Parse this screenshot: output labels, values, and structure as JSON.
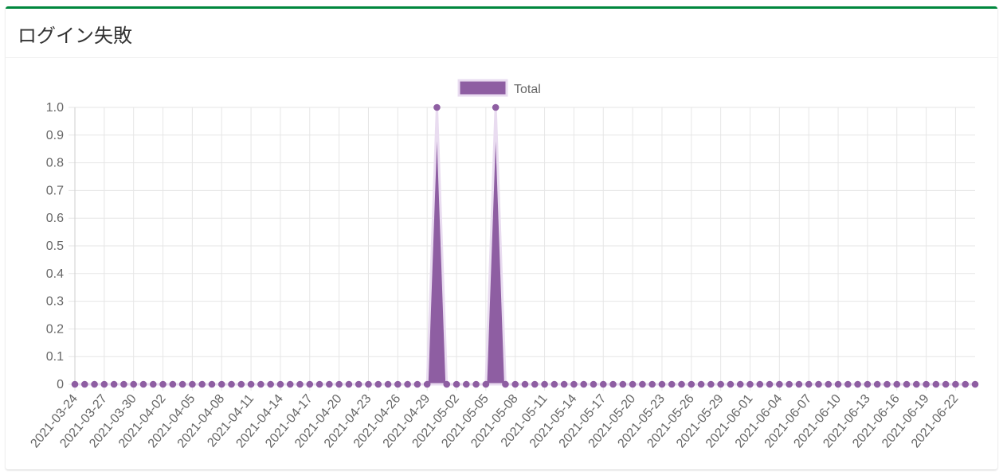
{
  "card": {
    "title": "ログイン失敗"
  },
  "chart_data": {
    "type": "area",
    "title": "",
    "xlabel": "",
    "ylabel": "",
    "series": [
      {
        "name": "Total",
        "color": "#8e5ea2"
      }
    ],
    "x_start": "2021-03-24",
    "x_end": "2021-06-24",
    "nonzero_points": [
      {
        "x": "2021-04-30",
        "y": 1
      },
      {
        "x": "2021-05-06",
        "y": 1
      }
    ],
    "default_y": 0,
    "x_tick_labels": [
      "2021-03-24",
      "2021-03-27",
      "2021-03-30",
      "2021-04-02",
      "2021-04-05",
      "2021-04-08",
      "2021-04-11",
      "2021-04-14",
      "2021-04-17",
      "2021-04-20",
      "2021-04-23",
      "2021-04-26",
      "2021-04-29",
      "2021-05-02",
      "2021-05-05",
      "2021-05-08",
      "2021-05-11",
      "2021-05-14",
      "2021-05-17",
      "2021-05-20",
      "2021-05-23",
      "2021-05-26",
      "2021-05-29",
      "2021-06-01",
      "2021-06-04",
      "2021-06-07",
      "2021-06-10",
      "2021-06-13",
      "2021-06-16",
      "2021-06-19",
      "2021-06-22"
    ],
    "y_tick_labels": [
      "0",
      "0.1",
      "0.2",
      "0.3",
      "0.4",
      "0.5",
      "0.6",
      "0.7",
      "0.8",
      "0.9",
      "1.0"
    ],
    "ylim": [
      0,
      1
    ],
    "grid": true,
    "legend_position": "top-center",
    "colors": {
      "fill": "#8e5ea2",
      "point": "#8e5ea2",
      "grid": "#e6e6e6",
      "axis": "#cfcfcf",
      "text": "#666666"
    }
  }
}
